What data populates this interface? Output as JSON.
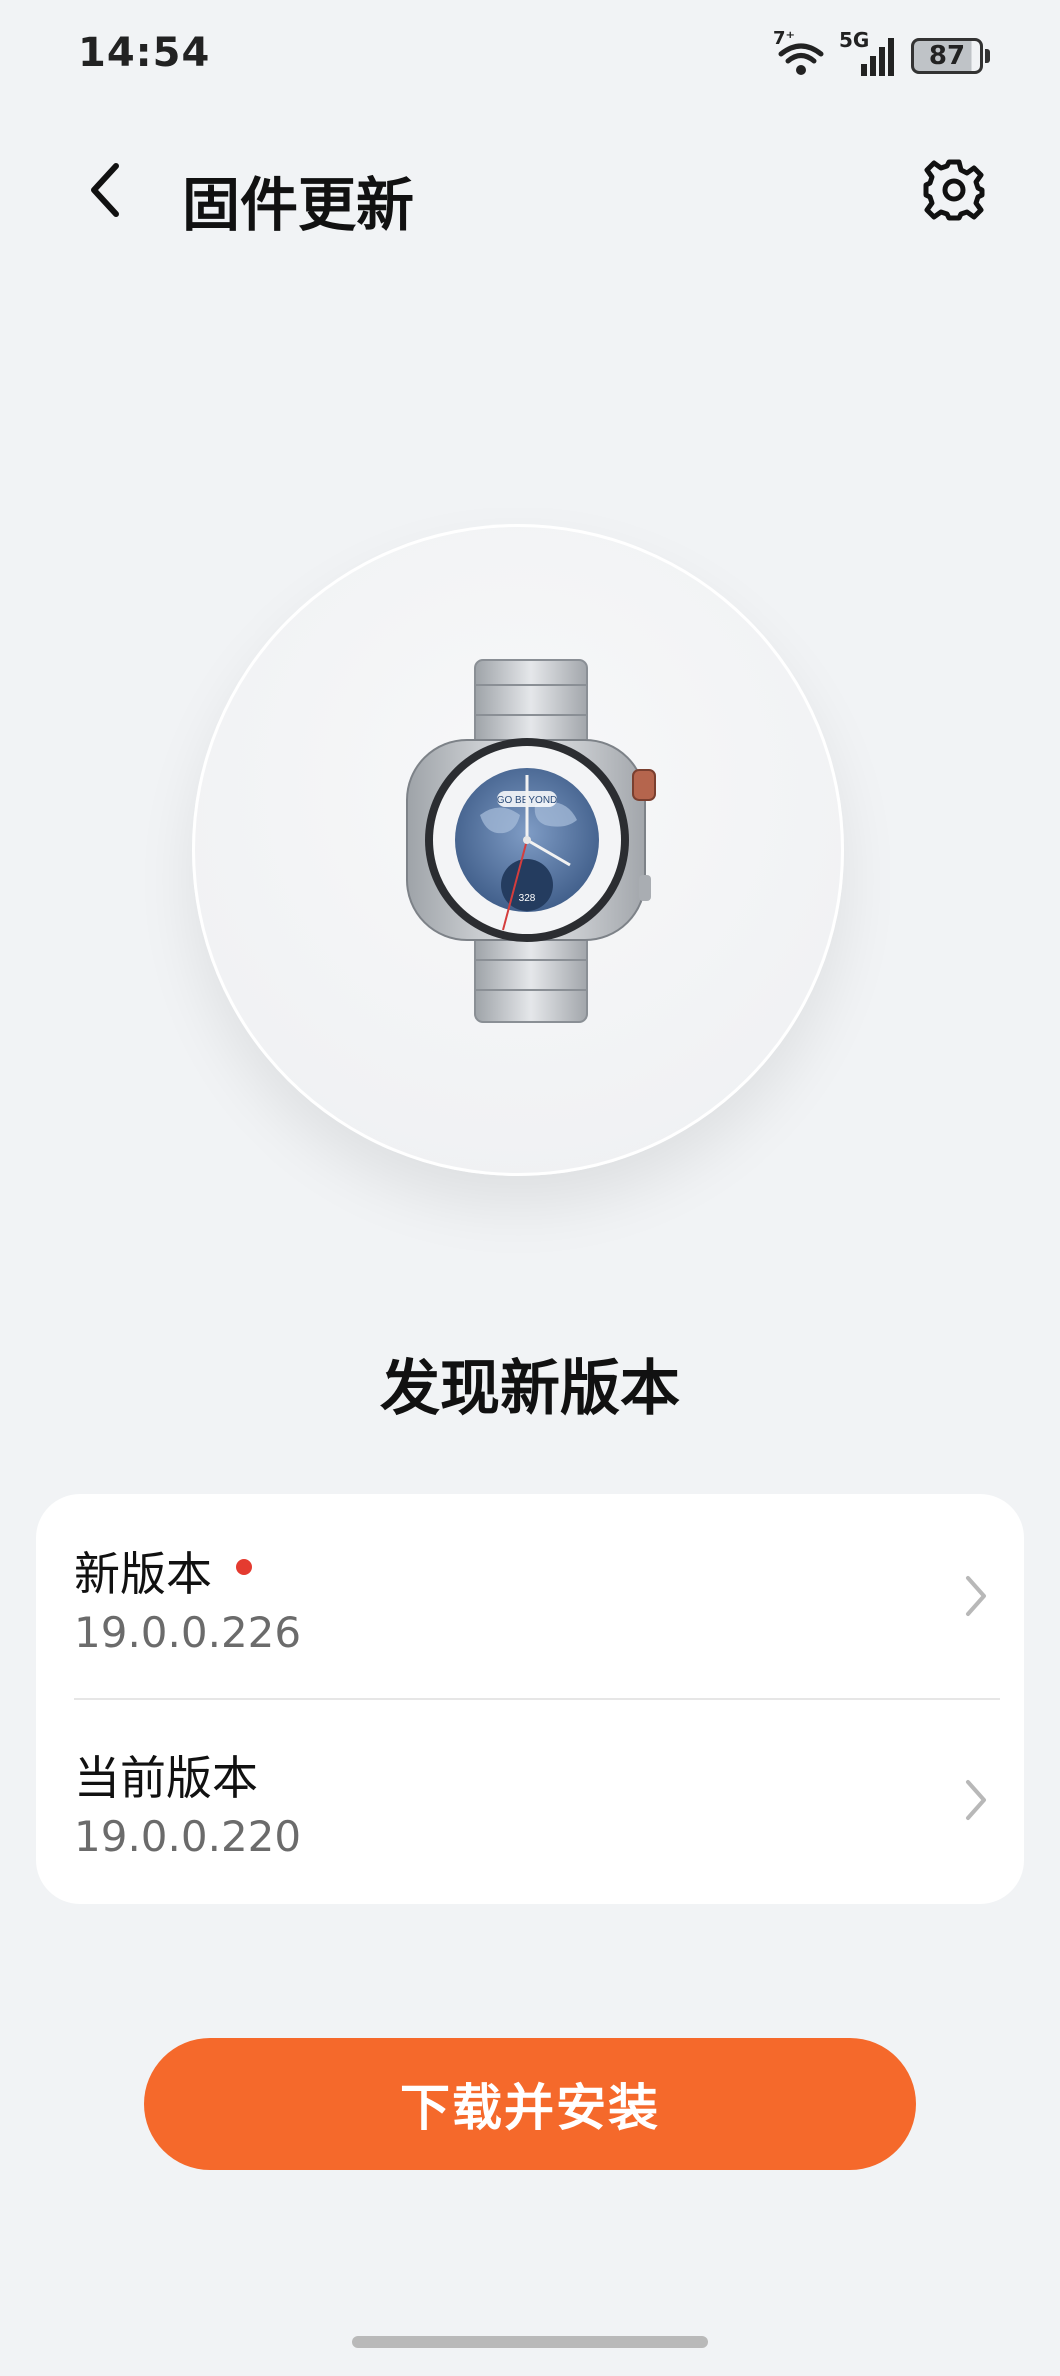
{
  "status_bar": {
    "time": "14:54",
    "wifi_badge": "7⁺",
    "network": "5G",
    "battery": "87",
    "icons": [
      "wifi-icon",
      "cellular-signal-icon",
      "battery-icon"
    ]
  },
  "header": {
    "title": "固件更新",
    "back_icon": "chevron-left-icon",
    "settings_icon": "gear-icon"
  },
  "device": {
    "image": "smartwatch-image",
    "face_text": "GO BEYOND",
    "face_value": "328"
  },
  "main": {
    "heading": "发现新版本"
  },
  "versions": {
    "new_label": "新版本",
    "new_value": "19.0.0.226",
    "current_label": "当前版本",
    "current_value": "19.0.0.220"
  },
  "actions": {
    "download_label": "下载并安装"
  },
  "colors": {
    "background": "#f1f3f5",
    "accent": "#f5692b",
    "badge_dot": "#e43b30"
  }
}
